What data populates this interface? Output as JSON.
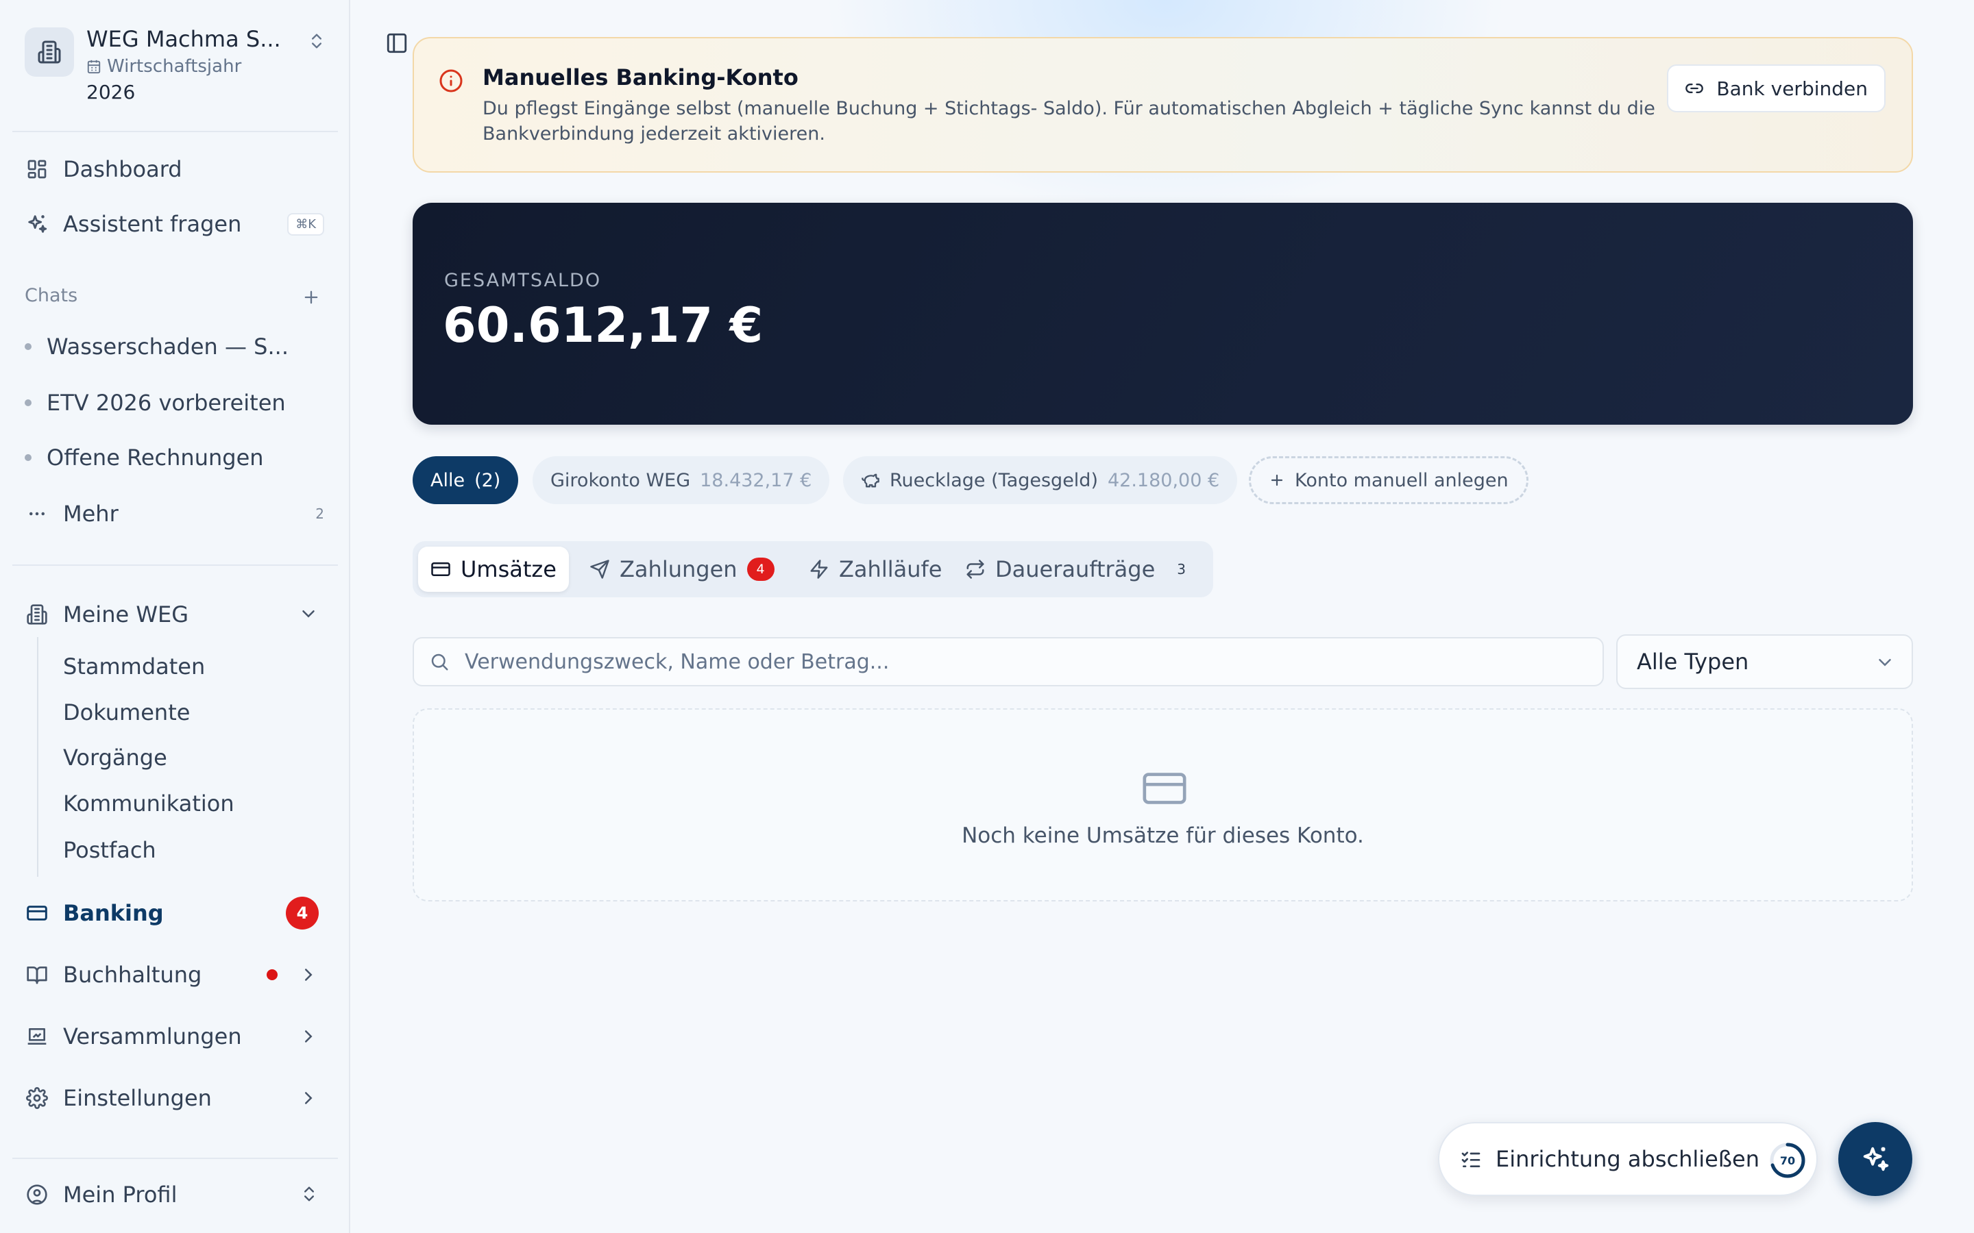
{
  "org": {
    "name": "WEG Machma S...",
    "year_label": "Wirtschaftsjahr",
    "year": "2026"
  },
  "nav": {
    "dashboard": "Dashboard",
    "assistant": "Assistent fragen",
    "assistant_shortcut": "⌘K"
  },
  "chats": {
    "label": "Chats",
    "items": [
      "Wasserschaden — S...",
      "ETV 2026 vorbereiten",
      "Offene Rechnungen"
    ],
    "more_label": "Mehr",
    "more_count": "2"
  },
  "weg": {
    "label": "Meine WEG",
    "sub": [
      "Stammdaten",
      "Dokumente",
      "Vorgänge",
      "Kommunikation",
      "Postfach"
    ]
  },
  "sections": {
    "banking": "Banking",
    "banking_badge": "4",
    "accounting": "Buchhaltung",
    "meetings": "Versammlungen",
    "settings": "Einstellungen",
    "profile": "Mein Profil"
  },
  "banner": {
    "title": "Manuelles Banking-Konto",
    "text": "Du pflegst Eingänge selbst (manuelle Buchung + Stichtags- Saldo). Für automatischen Abgleich + tägliche Sync kannst du die Bankverbindung jederzeit aktivieren.",
    "button": "Bank verbinden"
  },
  "balance": {
    "label": "GESAMTSALDO",
    "value": "60.612,17 €"
  },
  "accounts": {
    "all_label": "Alle",
    "all_count": "(2)",
    "items": [
      {
        "name": "Girokonto WEG",
        "amount": "18.432,17 €"
      },
      {
        "name": "Ruecklage (Tagesgeld)",
        "amount": "42.180,00 €"
      }
    ],
    "add_label": "Konto manuell anlegen"
  },
  "tabs": {
    "transactions": "Umsätze",
    "payments": "Zahlungen",
    "payments_badge": "4",
    "payment_runs": "Zahlläufe",
    "standing_orders": "Daueraufträge",
    "standing_orders_count": "3"
  },
  "filters": {
    "search_placeholder": "Verwendungszweck, Name oder Betrag...",
    "type_select": "Alle Typen"
  },
  "empty_state": {
    "text": "Noch keine Umsätze für dieses Konto."
  },
  "setup": {
    "label": "Einrichtung abschließen",
    "progress_percent": 70,
    "progress_text": "70"
  },
  "colors": {
    "brand": "#0d3a66",
    "alert_red": "#e11d1d",
    "banner_border": "#f3d8a8",
    "card_dark": "#111a2e"
  }
}
